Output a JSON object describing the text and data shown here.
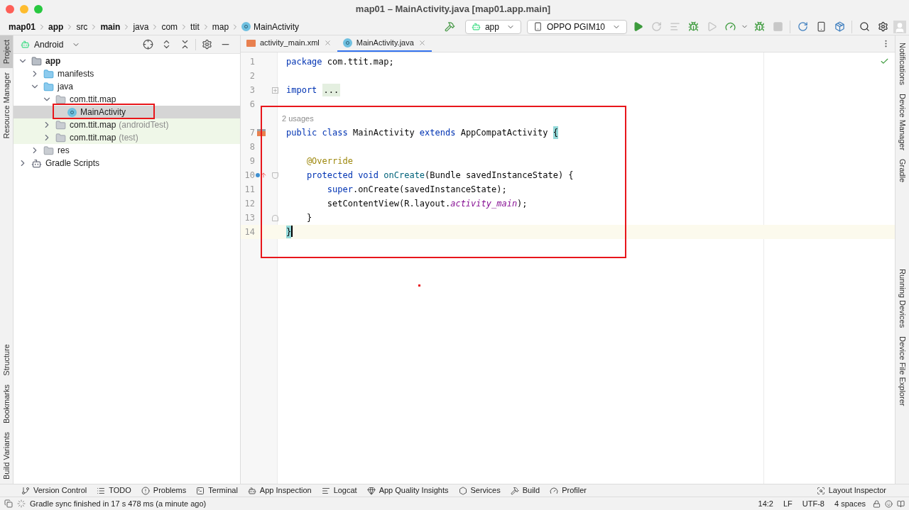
{
  "window": {
    "title": "map01 – MainActivity.java [map01.app.main]"
  },
  "breadcrumbs": [
    {
      "label": "map01",
      "bold": true,
      "kind": "folder"
    },
    {
      "label": "app",
      "bold": true,
      "kind": "folder"
    },
    {
      "label": "src",
      "bold": false,
      "kind": "folder"
    },
    {
      "label": "main",
      "bold": true,
      "kind": "folder"
    },
    {
      "label": "java",
      "bold": false,
      "kind": "folder"
    },
    {
      "label": "com",
      "bold": false,
      "kind": "folder"
    },
    {
      "label": "ttit",
      "bold": false,
      "kind": "folder"
    },
    {
      "label": "map",
      "bold": false,
      "kind": "folder"
    },
    {
      "label": "MainActivity",
      "bold": false,
      "kind": "class"
    }
  ],
  "toolbar": {
    "configuration": "app",
    "device": "OPPO PGIM10"
  },
  "left_tool_tabs": {
    "top": [
      {
        "label": "Project",
        "selected": true
      },
      {
        "label": "Resource Manager",
        "selected": false
      }
    ],
    "bottom": [
      {
        "label": "Structure",
        "selected": false
      },
      {
        "label": "Bookmarks",
        "selected": false
      },
      {
        "label": "Build Variants",
        "selected": false
      }
    ]
  },
  "project_panel": {
    "view": "Android",
    "tree": [
      {
        "label": "app",
        "kind": "module",
        "expanded": true,
        "selected": false,
        "tinted": false,
        "children": [
          {
            "label": "manifests",
            "kind": "folder",
            "expanded": false,
            "selected": false,
            "tinted": false
          },
          {
            "label": "java",
            "kind": "folder",
            "expanded": true,
            "selected": false,
            "tinted": false,
            "children": [
              {
                "label": "com.ttit.map",
                "kind": "package",
                "expanded": true,
                "selected": false,
                "tinted": false,
                "children": [
                  {
                    "label": "MainActivity",
                    "kind": "class",
                    "selected": true
                  }
                ]
              },
              {
                "label": "com.ttit.map",
                "note": "(androidTest)",
                "kind": "package",
                "expanded": false,
                "selected": false,
                "tinted": true
              },
              {
                "label": "com.ttit.map",
                "note": "(test)",
                "kind": "package",
                "expanded": false,
                "selected": false,
                "tinted": true
              }
            ]
          },
          {
            "label": "res",
            "kind": "res",
            "expanded": false,
            "selected": false,
            "tinted": false
          }
        ]
      },
      {
        "label": "Gradle Scripts",
        "kind": "gradle",
        "expanded": false,
        "selected": false,
        "tinted": false
      }
    ]
  },
  "editor": {
    "tabs": [
      {
        "label": "activity_main.xml",
        "kind": "xml",
        "selected": false
      },
      {
        "label": "MainActivity.java",
        "kind": "class",
        "selected": true
      }
    ],
    "lines": [
      {
        "number": "1",
        "current": false,
        "tokens": [
          {
            "kind": "keyword",
            "text": "package"
          },
          {
            "kind": "plain",
            "text": " com.ttit.map;"
          }
        ]
      },
      {
        "number": "2",
        "current": false
      },
      {
        "number": "3",
        "current": false,
        "fold": {
          "kind": "collapsed"
        },
        "tokens": [
          {
            "kind": "keyword",
            "text": "import "
          },
          {
            "kind": "folded",
            "text": "..."
          }
        ]
      },
      {
        "number": "6",
        "current": false
      },
      {
        "hint": "2 usages"
      },
      {
        "number": "7",
        "current": false,
        "marker": {
          "kind": "implemented"
        },
        "tokens": [
          {
            "kind": "keyword",
            "text": "public class"
          },
          {
            "kind": "plain",
            "text": " MainActivity "
          },
          {
            "kind": "keyword",
            "text": "extends"
          },
          {
            "kind": "plain",
            "text": " AppCompatActivity "
          },
          {
            "kind": "brace",
            "text": "{"
          }
        ]
      },
      {
        "number": "8",
        "current": false
      },
      {
        "number": "9",
        "current": false,
        "tokens": [
          {
            "kind": "annotation",
            "text": "    @Override"
          }
        ]
      },
      {
        "number": "10",
        "current": false,
        "marker": {
          "kind": "override"
        },
        "fold": {
          "kind": "start"
        },
        "tokens": [
          {
            "kind": "keyword",
            "text": "    protected void "
          },
          {
            "kind": "method",
            "text": "onCreate"
          },
          {
            "kind": "plain",
            "text": "(Bundle savedInstanceState) {"
          }
        ]
      },
      {
        "number": "11",
        "current": false,
        "tokens": [
          {
            "kind": "keyword",
            "text": "        super"
          },
          {
            "kind": "plain",
            "text": ".onCreate(savedInstanceState);"
          }
        ]
      },
      {
        "number": "12",
        "current": false,
        "tokens": [
          {
            "kind": "plain",
            "text": "        setContentView(R.layout."
          },
          {
            "kind": "field",
            "text": "activity_main"
          },
          {
            "kind": "plain",
            "text": ");"
          }
        ]
      },
      {
        "number": "13",
        "current": false,
        "fold": {
          "kind": "end"
        },
        "tokens": [
          {
            "kind": "plain",
            "text": "    }"
          }
        ]
      },
      {
        "number": "14",
        "current": true,
        "tokens": [
          {
            "kind": "brace",
            "text": "}"
          }
        ]
      }
    ]
  },
  "right_tool_tabs": [
    {
      "label": "Notifications",
      "selected": false
    },
    {
      "label": "Device Manager",
      "selected": false
    },
    {
      "label": "Gradle",
      "selected": false
    },
    {
      "label": "Running Devices",
      "selected": false
    },
    {
      "label": "Device File Explorer",
      "selected": false
    }
  ],
  "bottom_tools": {
    "left": [
      {
        "label": "Version Control",
        "kind": "vcs"
      },
      {
        "label": "TODO",
        "kind": "todo"
      },
      {
        "label": "Problems",
        "kind": "problems"
      },
      {
        "label": "Terminal",
        "kind": "terminal"
      },
      {
        "label": "App Inspection",
        "kind": "inspection"
      },
      {
        "label": "Logcat",
        "kind": "logcat"
      },
      {
        "label": "App Quality Insights",
        "kind": "quality"
      },
      {
        "label": "Services",
        "kind": "services"
      },
      {
        "label": "Build",
        "kind": "build"
      },
      {
        "label": "Profiler",
        "kind": "profiler"
      }
    ],
    "right": [
      {
        "label": "Layout Inspector",
        "kind": "layout"
      }
    ]
  },
  "status_bar": {
    "message": "Gradle sync finished in 17 s 478 ms (a minute ago)",
    "items": [
      "14:2",
      "LF",
      "UTF-8",
      "4 spaces"
    ]
  }
}
